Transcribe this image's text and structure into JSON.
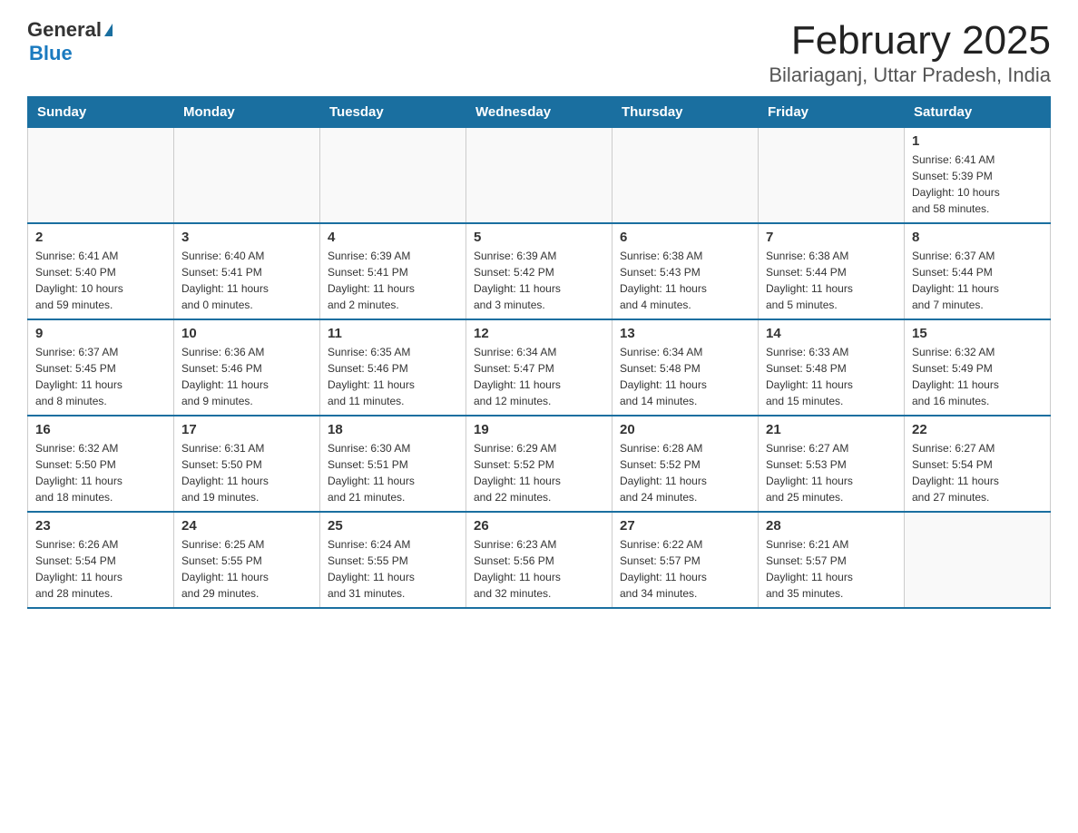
{
  "header": {
    "logo_general": "General",
    "logo_blue": "Blue",
    "month_title": "February 2025",
    "location": "Bilariaganj, Uttar Pradesh, India"
  },
  "weekdays": [
    "Sunday",
    "Monday",
    "Tuesday",
    "Wednesday",
    "Thursday",
    "Friday",
    "Saturday"
  ],
  "weeks": [
    [
      {
        "day": "",
        "info": ""
      },
      {
        "day": "",
        "info": ""
      },
      {
        "day": "",
        "info": ""
      },
      {
        "day": "",
        "info": ""
      },
      {
        "day": "",
        "info": ""
      },
      {
        "day": "",
        "info": ""
      },
      {
        "day": "1",
        "info": "Sunrise: 6:41 AM\nSunset: 5:39 PM\nDaylight: 10 hours\nand 58 minutes."
      }
    ],
    [
      {
        "day": "2",
        "info": "Sunrise: 6:41 AM\nSunset: 5:40 PM\nDaylight: 10 hours\nand 59 minutes."
      },
      {
        "day": "3",
        "info": "Sunrise: 6:40 AM\nSunset: 5:41 PM\nDaylight: 11 hours\nand 0 minutes."
      },
      {
        "day": "4",
        "info": "Sunrise: 6:39 AM\nSunset: 5:41 PM\nDaylight: 11 hours\nand 2 minutes."
      },
      {
        "day": "5",
        "info": "Sunrise: 6:39 AM\nSunset: 5:42 PM\nDaylight: 11 hours\nand 3 minutes."
      },
      {
        "day": "6",
        "info": "Sunrise: 6:38 AM\nSunset: 5:43 PM\nDaylight: 11 hours\nand 4 minutes."
      },
      {
        "day": "7",
        "info": "Sunrise: 6:38 AM\nSunset: 5:44 PM\nDaylight: 11 hours\nand 5 minutes."
      },
      {
        "day": "8",
        "info": "Sunrise: 6:37 AM\nSunset: 5:44 PM\nDaylight: 11 hours\nand 7 minutes."
      }
    ],
    [
      {
        "day": "9",
        "info": "Sunrise: 6:37 AM\nSunset: 5:45 PM\nDaylight: 11 hours\nand 8 minutes."
      },
      {
        "day": "10",
        "info": "Sunrise: 6:36 AM\nSunset: 5:46 PM\nDaylight: 11 hours\nand 9 minutes."
      },
      {
        "day": "11",
        "info": "Sunrise: 6:35 AM\nSunset: 5:46 PM\nDaylight: 11 hours\nand 11 minutes."
      },
      {
        "day": "12",
        "info": "Sunrise: 6:34 AM\nSunset: 5:47 PM\nDaylight: 11 hours\nand 12 minutes."
      },
      {
        "day": "13",
        "info": "Sunrise: 6:34 AM\nSunset: 5:48 PM\nDaylight: 11 hours\nand 14 minutes."
      },
      {
        "day": "14",
        "info": "Sunrise: 6:33 AM\nSunset: 5:48 PM\nDaylight: 11 hours\nand 15 minutes."
      },
      {
        "day": "15",
        "info": "Sunrise: 6:32 AM\nSunset: 5:49 PM\nDaylight: 11 hours\nand 16 minutes."
      }
    ],
    [
      {
        "day": "16",
        "info": "Sunrise: 6:32 AM\nSunset: 5:50 PM\nDaylight: 11 hours\nand 18 minutes."
      },
      {
        "day": "17",
        "info": "Sunrise: 6:31 AM\nSunset: 5:50 PM\nDaylight: 11 hours\nand 19 minutes."
      },
      {
        "day": "18",
        "info": "Sunrise: 6:30 AM\nSunset: 5:51 PM\nDaylight: 11 hours\nand 21 minutes."
      },
      {
        "day": "19",
        "info": "Sunrise: 6:29 AM\nSunset: 5:52 PM\nDaylight: 11 hours\nand 22 minutes."
      },
      {
        "day": "20",
        "info": "Sunrise: 6:28 AM\nSunset: 5:52 PM\nDaylight: 11 hours\nand 24 minutes."
      },
      {
        "day": "21",
        "info": "Sunrise: 6:27 AM\nSunset: 5:53 PM\nDaylight: 11 hours\nand 25 minutes."
      },
      {
        "day": "22",
        "info": "Sunrise: 6:27 AM\nSunset: 5:54 PM\nDaylight: 11 hours\nand 27 minutes."
      }
    ],
    [
      {
        "day": "23",
        "info": "Sunrise: 6:26 AM\nSunset: 5:54 PM\nDaylight: 11 hours\nand 28 minutes."
      },
      {
        "day": "24",
        "info": "Sunrise: 6:25 AM\nSunset: 5:55 PM\nDaylight: 11 hours\nand 29 minutes."
      },
      {
        "day": "25",
        "info": "Sunrise: 6:24 AM\nSunset: 5:55 PM\nDaylight: 11 hours\nand 31 minutes."
      },
      {
        "day": "26",
        "info": "Sunrise: 6:23 AM\nSunset: 5:56 PM\nDaylight: 11 hours\nand 32 minutes."
      },
      {
        "day": "27",
        "info": "Sunrise: 6:22 AM\nSunset: 5:57 PM\nDaylight: 11 hours\nand 34 minutes."
      },
      {
        "day": "28",
        "info": "Sunrise: 6:21 AM\nSunset: 5:57 PM\nDaylight: 11 hours\nand 35 minutes."
      },
      {
        "day": "",
        "info": ""
      }
    ]
  ]
}
